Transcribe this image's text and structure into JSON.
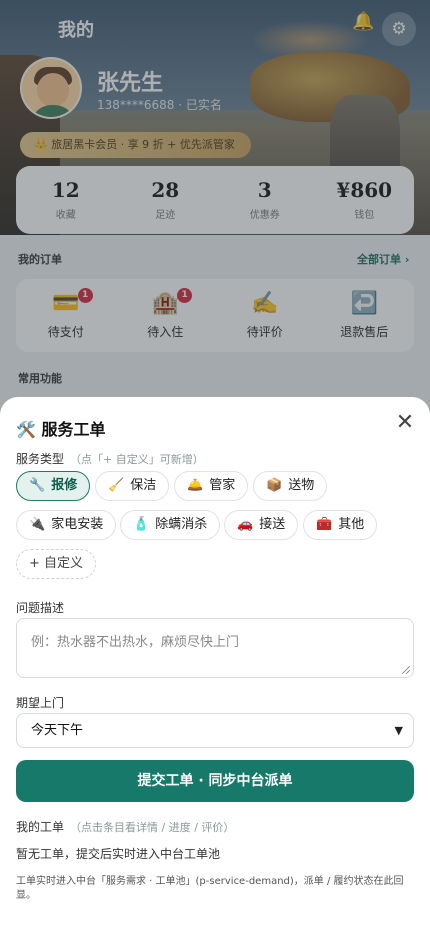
{
  "header": {
    "title": "我的"
  },
  "profile": {
    "name": "张先生",
    "phone": "138****6688 · 已实名"
  },
  "vip": {
    "text": "👑 旅居黑卡会员 · 享 9 折 + 优先派管家"
  },
  "stats": [
    {
      "value": "12",
      "label": "收藏"
    },
    {
      "value": "28",
      "label": "足迹"
    },
    {
      "value": "3",
      "label": "优惠券"
    },
    {
      "value": "¥860",
      "label": "钱包"
    }
  ],
  "orders": {
    "title": "我的订单",
    "all_label": "全部订单 ›",
    "items": [
      {
        "icon": "💳",
        "icon_name": "card-icon",
        "label": "待支付",
        "badge": "1"
      },
      {
        "icon": "🏨",
        "icon_name": "hotel-icon",
        "label": "待入住",
        "badge": "1"
      },
      {
        "icon": "✍️",
        "icon_name": "pen-icon",
        "label": "待评价",
        "badge": ""
      },
      {
        "icon": "↩️",
        "icon_name": "return-icon",
        "label": "退款售后",
        "badge": ""
      }
    ]
  },
  "common": {
    "title": "常用功能"
  },
  "sheet": {
    "title": "🛠️ 服务工单",
    "close": "✕",
    "type_label": "服务类型",
    "type_hint": "（点「+ 自定义」可新增）",
    "types": [
      {
        "icon": "🔧",
        "label": "报修"
      },
      {
        "icon": "🧹",
        "label": "保洁"
      },
      {
        "icon": "🛎️",
        "label": "管家"
      },
      {
        "icon": "📦",
        "label": "送物"
      },
      {
        "icon": "🔌",
        "label": "家电安装"
      },
      {
        "icon": "🧴",
        "label": "除螨消杀"
      },
      {
        "icon": "🚗",
        "label": "接送"
      },
      {
        "icon": "🧰",
        "label": "其他"
      }
    ],
    "custom_label": "+ 自定义",
    "desc_label": "问题描述",
    "desc_placeholder": "例：热水器不出热水，麻烦尽快上门",
    "time_label": "期望上门",
    "time_value": "今天下午",
    "submit_label": "提交工单 · 同步中台派单",
    "my_label": "我的工单",
    "my_hint": "（点击条目看详情 / 进度 / 评价）",
    "empty_text": "暂无工单，提交后实时进入中台工单池",
    "footnote": "工单实时进入中台「服务需求 · 工单池」(p-service-demand)，派单 / 履约状态在此回显。"
  },
  "colors": {
    "accent": "#16796a",
    "badge": "#d8233a",
    "vip": "#e7c98a"
  }
}
